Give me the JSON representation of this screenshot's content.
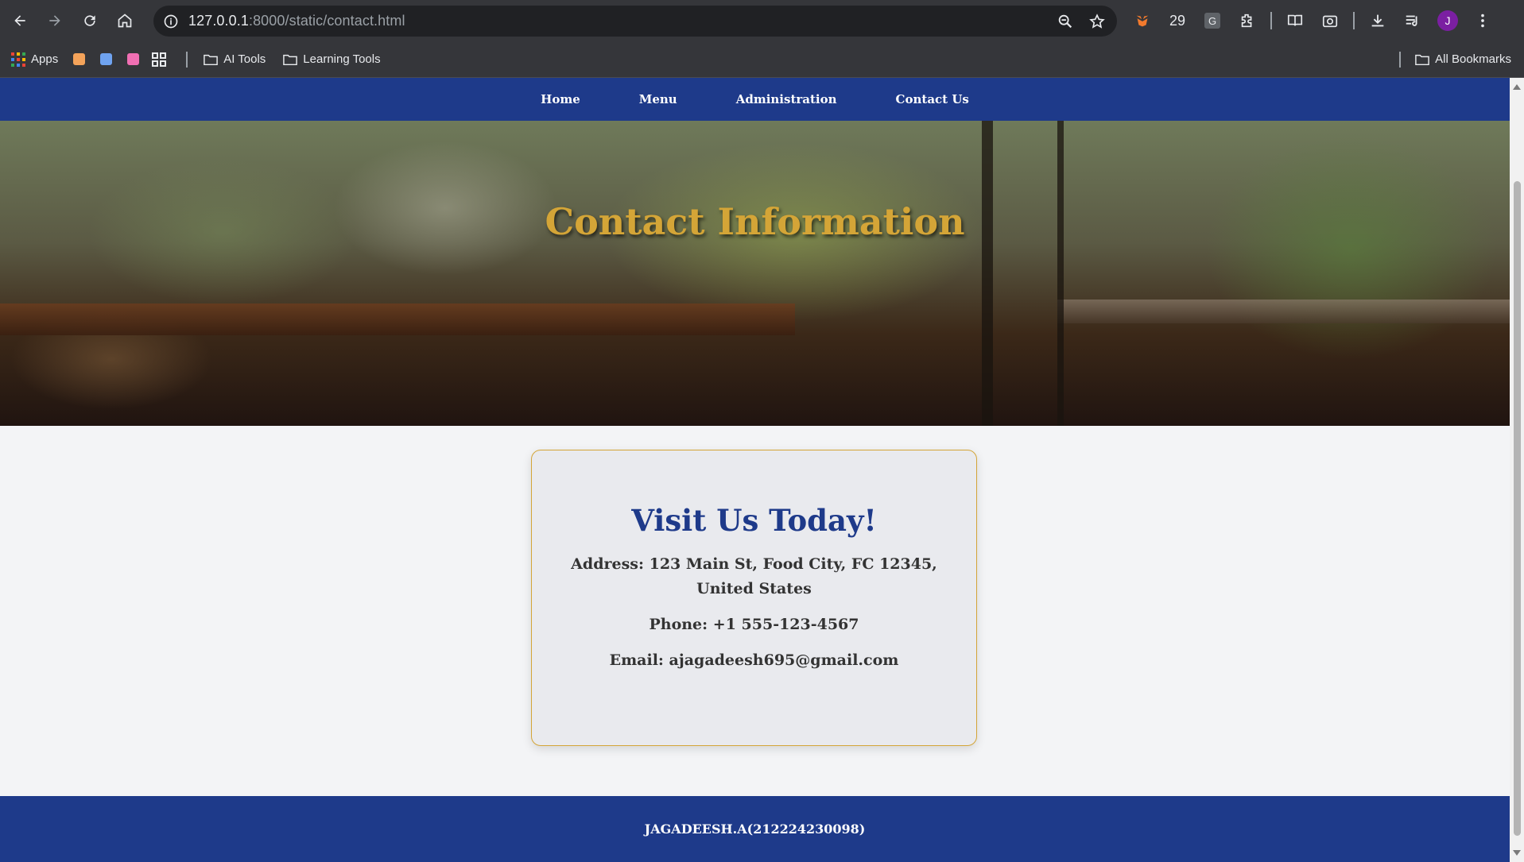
{
  "browser": {
    "url_host": "127.0.0.1",
    "url_rest": ":8000/static/contact.html",
    "extension_count": "29",
    "extension_g_label": "G",
    "avatar_initial": "J"
  },
  "bookmarks": {
    "apps_label": "Apps",
    "folders": [
      "AI Tools",
      "Learning Tools"
    ],
    "all_bookmarks": "All Bookmarks",
    "colored_icons": [
      "#f4a35a",
      "#6fa3f0",
      "#f06fb3"
    ]
  },
  "site_nav": {
    "items": [
      "Home",
      "Menu",
      "Administration",
      "Contact Us"
    ]
  },
  "hero": {
    "title": "Contact Information"
  },
  "contact_card": {
    "heading": "Visit Us Today!",
    "address": "Address: 123 Main St, Food City, FC 12345, United States",
    "phone": "Phone: +1 555-123-4567",
    "email": "Email: ajagadeesh695@gmail.com"
  },
  "footer": {
    "text": "JAGADEESH.A(212224230098)"
  },
  "colors": {
    "nav_bg": "#1e3a8a",
    "accent_gold": "#d4a537",
    "heading_blue": "#1e3a8a"
  }
}
